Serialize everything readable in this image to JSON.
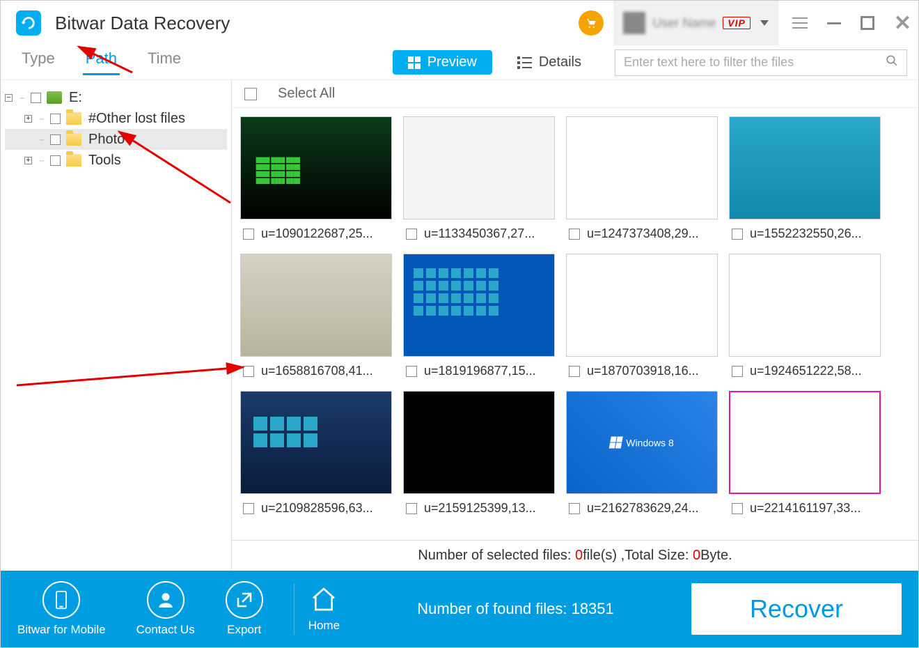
{
  "app": {
    "title": "Bitwar Data Recovery"
  },
  "titlebar": {
    "user_name": "User Name",
    "vip_label": "VIP"
  },
  "tabs": {
    "type": "Type",
    "path": "Path",
    "time": "Time",
    "active": "path"
  },
  "view": {
    "preview": "Preview",
    "details": "Details"
  },
  "search": {
    "placeholder": "Enter text here to filter the files"
  },
  "tree": {
    "root": "E:",
    "items": [
      {
        "label": "#Other lost files",
        "expandable": true
      },
      {
        "label": "Photo",
        "expandable": false,
        "selected": true
      },
      {
        "label": "Tools",
        "expandable": true
      }
    ]
  },
  "select_all_label": "Select All",
  "files": [
    {
      "name": "u=1090122687,25...",
      "th": "th-a"
    },
    {
      "name": "u=1133450367,27...",
      "th": "th-b"
    },
    {
      "name": "u=1247373408,29...",
      "th": "th-c"
    },
    {
      "name": "u=1552232550,26...",
      "th": "th-d"
    },
    {
      "name": "u=1658816708,41...",
      "th": "th-e"
    },
    {
      "name": "u=1819196877,15...",
      "th": "th-f"
    },
    {
      "name": "u=1870703918,16...",
      "th": "th-g"
    },
    {
      "name": "u=1924651222,58...",
      "th": "th-h"
    },
    {
      "name": "u=2109828596,63...",
      "th": "th-i"
    },
    {
      "name": "u=2159125399,13...",
      "th": "th-j"
    },
    {
      "name": "u=2162783629,24...",
      "th": "th-k"
    },
    {
      "name": "u=2214161197,33...",
      "th": "th-l"
    }
  ],
  "status": {
    "prefix": "Number of selected files: ",
    "count": "0",
    "mid": "file(s) ,Total Size: ",
    "size": "0",
    "suffix": "Byte."
  },
  "bottombar": {
    "mobile": "Bitwar for Mobile",
    "contact": "Contact Us",
    "export": "Export",
    "home": "Home",
    "found_prefix": "Number of found files: ",
    "found_count": "18351",
    "recover": "Recover"
  },
  "win8_label": "Windows 8"
}
